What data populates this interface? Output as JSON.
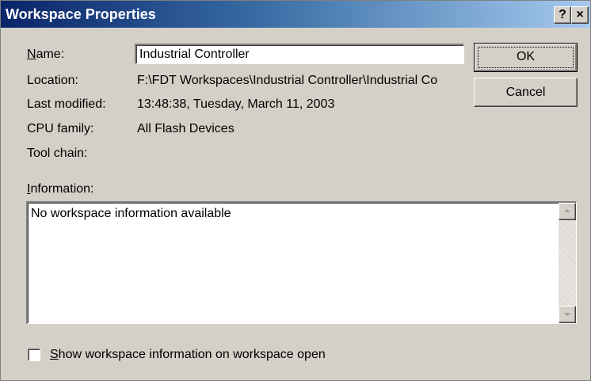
{
  "window": {
    "title": "Workspace Properties",
    "help_label": "?",
    "close_label": "×"
  },
  "fields": {
    "name_label_mnemonic": "N",
    "name_label_rest": "ame:",
    "name_value": "Industrial Controller",
    "location_label": "Location:",
    "location_value": "F:\\FDT Workspaces\\Industrial Controller\\Industrial Co",
    "last_modified_label": "Last modified:",
    "last_modified_value": "13:48:38, Tuesday, March 11, 2003",
    "cpu_family_label": "CPU family:",
    "cpu_family_value": "All Flash Devices",
    "tool_chain_label": "Tool chain:",
    "tool_chain_value": ""
  },
  "information": {
    "label_mnemonic": "I",
    "label_rest": "nformation:",
    "text": "No workspace information available"
  },
  "buttons": {
    "ok": "OK",
    "cancel": "Cancel"
  },
  "checkbox": {
    "label_mnemonic": "S",
    "label_rest": "how workspace information on workspace open",
    "checked": false
  },
  "colors": {
    "titlebar_start": "#0a246a",
    "titlebar_end": "#a6caf0",
    "dialog_face": "#d4d0c8"
  }
}
